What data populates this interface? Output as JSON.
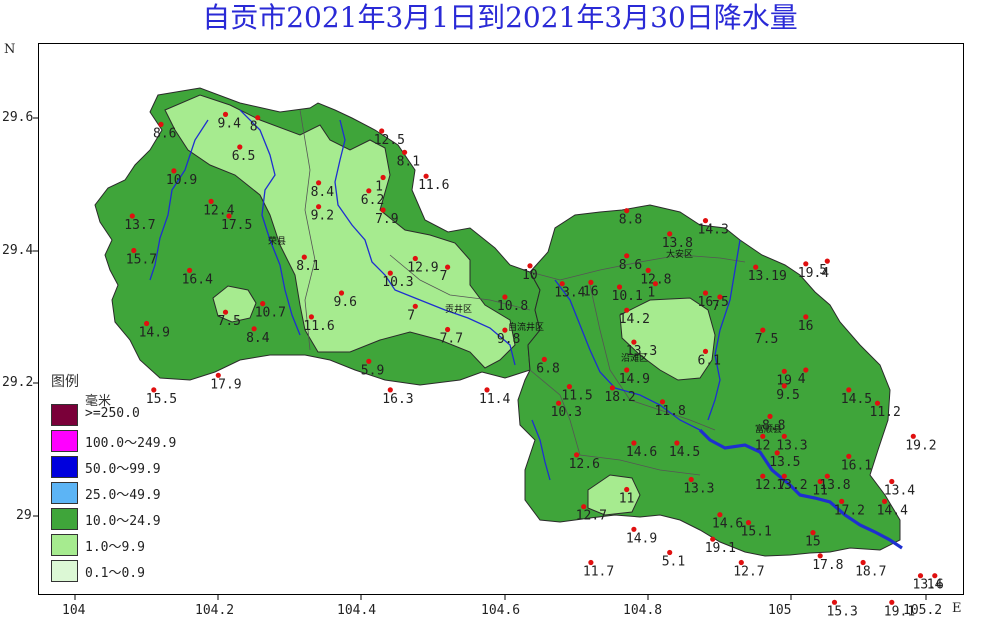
{
  "title": "自贡市2021年3月1日到2021年3月30日降水量",
  "axes": {
    "x_ticks": [
      "104",
      "104.2",
      "104.4",
      "104.6",
      "104.8",
      "105",
      "105.2"
    ],
    "y_ticks": [
      "29.6",
      "29.4",
      "29.2",
      "29"
    ],
    "x_letter": "E",
    "y_letter": "N"
  },
  "legend": {
    "title": "图例",
    "unit": "毫米",
    "classes": [
      {
        "label": ">=250.0",
        "color": "#7a0039"
      },
      {
        "label": "100.0～249.9",
        "color": "#ff00ff"
      },
      {
        "label": "50.0～99.9",
        "color": "#0000dd"
      },
      {
        "label": "25.0～49.9",
        "color": "#5cb4f5"
      },
      {
        "label": "10.0～24.9",
        "color": "#3fa53a"
      },
      {
        "label": "1.0～9.9",
        "color": "#a6eb8f"
      },
      {
        "label": "0.1～0.9",
        "color": "#dcf8d5"
      }
    ]
  },
  "district_labels": [
    "荣县",
    "贡井区",
    "自流井区",
    "大安区",
    "沿滩区",
    "富顺县"
  ],
  "stations": [
    {
      "value": "8.6",
      "lon": 104.12,
      "lat": 29.59
    },
    {
      "value": "9.4",
      "lon": 104.21,
      "lat": 29.605
    },
    {
      "value": "8",
      "lon": 104.255,
      "lat": 29.6
    },
    {
      "value": "6.5",
      "lon": 104.23,
      "lat": 29.556
    },
    {
      "value": "12.5",
      "lon": 104.428,
      "lat": 29.58
    },
    {
      "value": "8.1",
      "lon": 104.46,
      "lat": 29.548
    },
    {
      "value": "10.9",
      "lon": 104.138,
      "lat": 29.52
    },
    {
      "value": "11.6",
      "lon": 104.49,
      "lat": 29.512
    },
    {
      "value": "8.4",
      "lon": 104.34,
      "lat": 29.502
    },
    {
      "value": "1",
      "lon": 104.43,
      "lat": 29.51
    },
    {
      "value": "6.2",
      "lon": 104.41,
      "lat": 29.49
    },
    {
      "value": "12.4",
      "lon": 104.19,
      "lat": 29.474
    },
    {
      "value": "9.2",
      "lon": 104.34,
      "lat": 29.466
    },
    {
      "value": "17.5",
      "lon": 104.215,
      "lat": 29.452
    },
    {
      "value": "7.9",
      "lon": 104.43,
      "lat": 29.461
    },
    {
      "value": "13.7",
      "lon": 104.08,
      "lat": 29.452
    },
    {
      "value": "15.7",
      "lon": 104.082,
      "lat": 29.4
    },
    {
      "value": "8.1",
      "lon": 104.32,
      "lat": 29.39
    },
    {
      "value": "12.9",
      "lon": 104.475,
      "lat": 29.388
    },
    {
      "value": "7",
      "lon": 104.52,
      "lat": 29.375
    },
    {
      "value": "10.3",
      "lon": 104.44,
      "lat": 29.366
    },
    {
      "value": "16.4",
      "lon": 104.16,
      "lat": 29.37
    },
    {
      "value": "10",
      "lon": 104.635,
      "lat": 29.377
    },
    {
      "value": "13.4",
      "lon": 104.68,
      "lat": 29.35
    },
    {
      "value": "9.6",
      "lon": 104.372,
      "lat": 29.336
    },
    {
      "value": "7",
      "lon": 104.475,
      "lat": 29.316
    },
    {
      "value": "10.8",
      "lon": 104.6,
      "lat": 29.33
    },
    {
      "value": "10.7",
      "lon": 104.262,
      "lat": 29.32
    },
    {
      "value": "7.5",
      "lon": 104.21,
      "lat": 29.307
    },
    {
      "value": "11.6",
      "lon": 104.33,
      "lat": 29.3
    },
    {
      "value": "8.4",
      "lon": 104.25,
      "lat": 29.282
    },
    {
      "value": "14.9",
      "lon": 104.1,
      "lat": 29.29
    },
    {
      "value": "7.7",
      "lon": 104.52,
      "lat": 29.281
    },
    {
      "value": "9.8",
      "lon": 104.6,
      "lat": 29.28
    },
    {
      "value": "5.9",
      "lon": 104.41,
      "lat": 29.233
    },
    {
      "value": "6.8",
      "lon": 104.655,
      "lat": 29.236
    },
    {
      "value": "17.9",
      "lon": 104.2,
      "lat": 29.212
    },
    {
      "value": "16.3",
      "lon": 104.44,
      "lat": 29.19
    },
    {
      "value": "11.4",
      "lon": 104.575,
      "lat": 29.19
    },
    {
      "value": "15.5",
      "lon": 104.11,
      "lat": 29.19
    },
    {
      "value": "11.5",
      "lon": 104.69,
      "lat": 29.195
    },
    {
      "value": "10.3",
      "lon": 104.675,
      "lat": 29.17
    },
    {
      "value": "8.8",
      "lon": 104.77,
      "lat": 29.46
    },
    {
      "value": "14.3",
      "lon": 104.88,
      "lat": 29.445
    },
    {
      "value": "13.8",
      "lon": 104.83,
      "lat": 29.425
    },
    {
      "value": "8.6",
      "lon": 104.77,
      "lat": 29.392
    },
    {
      "value": "12.8",
      "lon": 104.8,
      "lat": 29.37
    },
    {
      "value": "16",
      "lon": 104.72,
      "lat": 29.352
    },
    {
      "value": "10.1",
      "lon": 104.76,
      "lat": 29.345
    },
    {
      "value": "1",
      "lon": 104.81,
      "lat": 29.35
    },
    {
      "value": "13.19",
      "lon": 104.95,
      "lat": 29.375
    },
    {
      "value": "19.4",
      "lon": 105.02,
      "lat": 29.38
    },
    {
      "value": "5",
      "lon": 105.05,
      "lat": 29.384
    },
    {
      "value": "16.5",
      "lon": 104.88,
      "lat": 29.336
    },
    {
      "value": "7",
      "lon": 104.9,
      "lat": 29.33
    },
    {
      "value": "14.2",
      "lon": 104.77,
      "lat": 29.31
    },
    {
      "value": "16",
      "lon": 105.02,
      "lat": 29.3
    },
    {
      "value": "7.5",
      "lon": 104.96,
      "lat": 29.28
    },
    {
      "value": "13.3",
      "lon": 104.78,
      "lat": 29.262
    },
    {
      "value": "14.9",
      "lon": 104.77,
      "lat": 29.22
    },
    {
      "value": "6.1",
      "lon": 104.88,
      "lat": 29.248
    },
    {
      "value": "19",
      "lon": 104.99,
      "lat": 29.218
    },
    {
      "value": "4",
      "lon": 105.02,
      "lat": 29.22
    },
    {
      "value": "18.2",
      "lon": 104.75,
      "lat": 29.193
    },
    {
      "value": "9.5",
      "lon": 104.99,
      "lat": 29.196
    },
    {
      "value": "14.5",
      "lon": 105.08,
      "lat": 29.19
    },
    {
      "value": "11.2",
      "lon": 105.12,
      "lat": 29.17
    },
    {
      "value": "11.8",
      "lon": 104.82,
      "lat": 29.172
    },
    {
      "value": "8.8",
      "lon": 104.97,
      "lat": 29.15
    },
    {
      "value": "19.2",
      "lon": 105.17,
      "lat": 29.12
    },
    {
      "value": "14.6",
      "lon": 104.78,
      "lat": 29.11
    },
    {
      "value": "14.5",
      "lon": 104.84,
      "lat": 29.11
    },
    {
      "value": "12",
      "lon": 104.96,
      "lat": 29.12
    },
    {
      "value": "13.3",
      "lon": 104.99,
      "lat": 29.12
    },
    {
      "value": "12.6",
      "lon": 104.7,
      "lat": 29.092
    },
    {
      "value": "16.1",
      "lon": 105.08,
      "lat": 29.09
    },
    {
      "value": "13.5",
      "lon": 104.98,
      "lat": 29.095
    },
    {
      "value": "12.7",
      "lon": 104.96,
      "lat": 29.06
    },
    {
      "value": "13.2",
      "lon": 104.99,
      "lat": 29.06
    },
    {
      "value": "11",
      "lon": 105.04,
      "lat": 29.052
    },
    {
      "value": "13.8",
      "lon": 105.05,
      "lat": 29.06
    },
    {
      "value": "13.3",
      "lon": 104.86,
      "lat": 29.055
    },
    {
      "value": "13.4",
      "lon": 105.14,
      "lat": 29.052
    },
    {
      "value": "11",
      "lon": 104.77,
      "lat": 29.04
    },
    {
      "value": "17.2",
      "lon": 105.07,
      "lat": 29.022
    },
    {
      "value": "14.4",
      "lon": 105.13,
      "lat": 29.022
    },
    {
      "value": "12.7",
      "lon": 104.71,
      "lat": 29.014
    },
    {
      "value": "14.6",
      "lon": 104.9,
      "lat": 29.002
    },
    {
      "value": "15.1",
      "lon": 104.94,
      "lat": 28.99
    },
    {
      "value": "15",
      "lon": 105.03,
      "lat": 28.975
    },
    {
      "value": "14.9",
      "lon": 104.78,
      "lat": 28.98
    },
    {
      "value": "19.1",
      "lon": 104.89,
      "lat": 28.965
    },
    {
      "value": "5.1",
      "lon": 104.83,
      "lat": 28.945
    },
    {
      "value": "11.7",
      "lon": 104.72,
      "lat": 28.93
    },
    {
      "value": "17.8",
      "lon": 105.04,
      "lat": 28.94
    },
    {
      "value": "12.7",
      "lon": 104.93,
      "lat": 28.93
    },
    {
      "value": "18.7",
      "lon": 105.1,
      "lat": 28.93
    },
    {
      "value": "13.6",
      "lon": 105.18,
      "lat": 28.91
    },
    {
      "value": "14",
      "lon": 105.2,
      "lat": 28.91
    },
    {
      "value": "15.3",
      "lon": 105.06,
      "lat": 28.87
    },
    {
      "value": "19.1",
      "lon": 105.14,
      "lat": 28.87
    }
  ]
}
